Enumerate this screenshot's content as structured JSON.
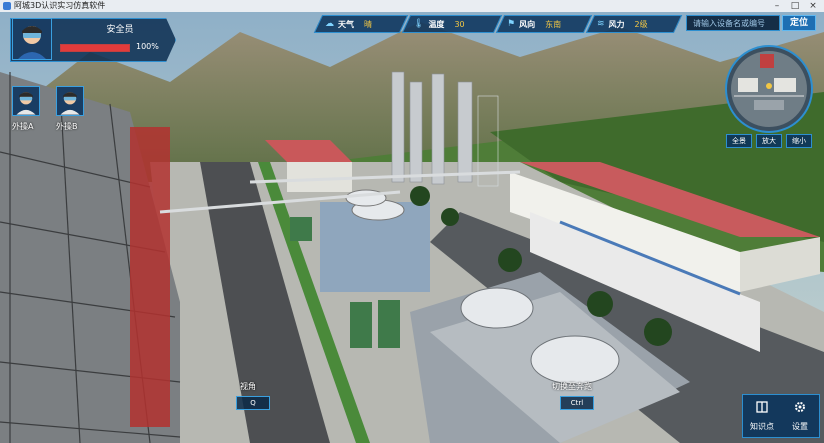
{
  "window": {
    "title": "阿城3D认识实习仿真软件"
  },
  "weather": [
    {
      "icon": "cloud-icon",
      "label": "天气",
      "value": "晴"
    },
    {
      "icon": "thermometer-icon",
      "label": "温度",
      "value": "30"
    },
    {
      "icon": "flag-icon",
      "label": "风向",
      "value": "东南"
    },
    {
      "icon": "wind-icon",
      "label": "风力",
      "value": "2级"
    }
  ],
  "search": {
    "placeholder": "请输入设备名或编号",
    "button": "定位"
  },
  "player": {
    "role": "安全员",
    "health": "100%",
    "health_fraction": 1.0
  },
  "teammates": [
    {
      "label": "外操A"
    },
    {
      "label": "外操B"
    }
  ],
  "minimap": {
    "buttons": [
      "全景",
      "放大",
      "缩小"
    ]
  },
  "hints": {
    "view": {
      "label": "视角",
      "key": "Q"
    },
    "switch": {
      "label": "切换至奔跑",
      "key": "Ctrl"
    }
  },
  "toolbar": {
    "knowledge": "知识点",
    "settings": "设置"
  },
  "colors": {
    "panel": "#0c345c",
    "border": "#2d8fd0",
    "accent": "#f2c744",
    "health": "#e23b3b"
  }
}
